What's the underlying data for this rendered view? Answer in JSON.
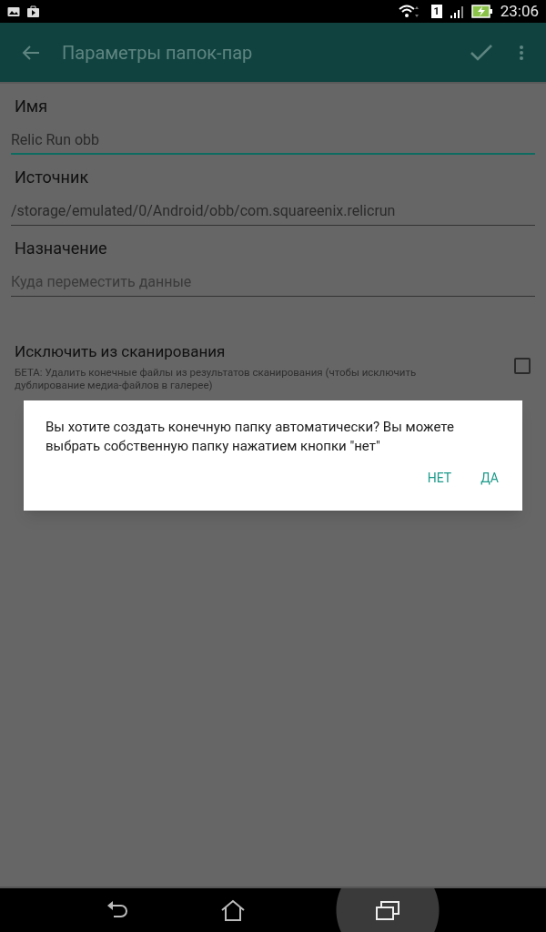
{
  "status_bar": {
    "sim": "1",
    "time": "23:06"
  },
  "toolbar": {
    "title": "Параметры папок-пар"
  },
  "fields": [
    {
      "label": "Имя",
      "value": "Relic Run obb",
      "focused": true
    },
    {
      "label": "Источник",
      "value": "/storage/emulated/0/Android/obb/com.squareenix.relicrun",
      "focused": false
    },
    {
      "label": "Назначение",
      "placeholder": "Куда переместить данные",
      "focused": false
    }
  ],
  "exclude_option": {
    "title": "Исключить из сканирования",
    "description": "БЕТА: Удалить конечные файлы из результатов сканирования (чтобы исключить дублирование медиа-файлов в галерее)",
    "checked": false
  },
  "dialog": {
    "message": "Вы хотите создать конечную папку автоматически? Вы можете выбрать собственную папку нажатием кнопки \"нет\"",
    "buttons": [
      "НЕТ",
      "ДА"
    ]
  }
}
